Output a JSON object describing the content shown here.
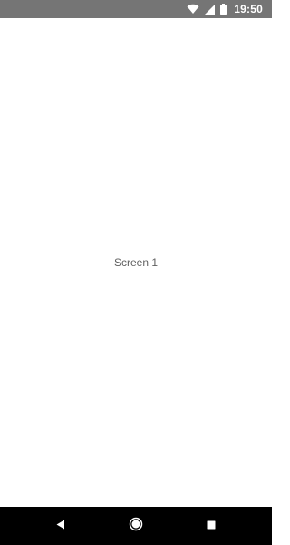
{
  "status_bar": {
    "time": "19:50",
    "background_color": "#757575",
    "icons": [
      "wifi-icon",
      "cell-signal-icon",
      "battery-icon"
    ]
  },
  "main": {
    "label": "Screen 1"
  },
  "nav_bar": {
    "background_color": "#000000",
    "buttons": [
      "back-icon",
      "home-icon",
      "recents-icon"
    ]
  }
}
